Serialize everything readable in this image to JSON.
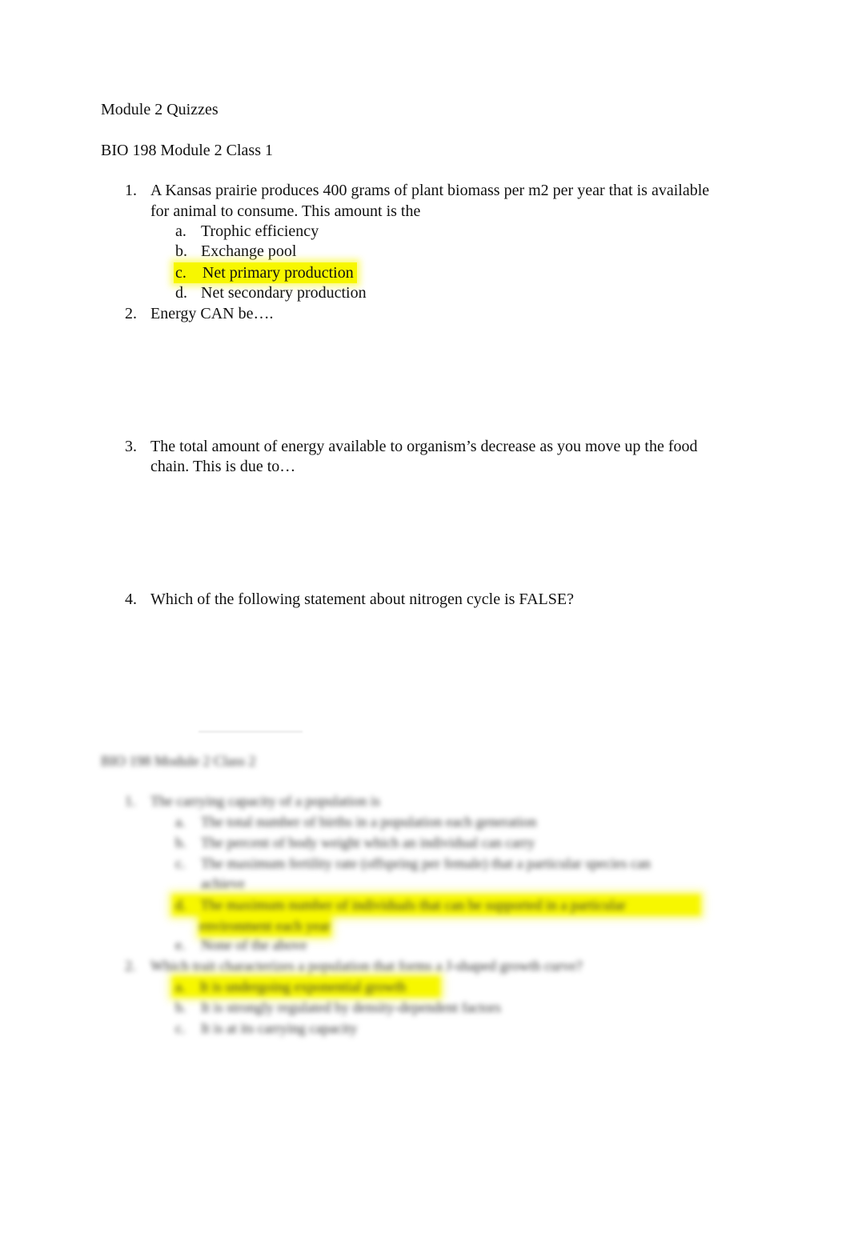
{
  "document": {
    "title": "Module 2 Quizzes",
    "section1": {
      "heading": "BIO 198 Module 2 Class 1",
      "questions": [
        {
          "num": "1.",
          "lines": [
            "A Kansas prairie produces 400 grams of plant biomass per m2 per year that is available",
            "for animal to consume. This amount is the"
          ],
          "options": [
            {
              "letter": "a.",
              "text": "Trophic efficiency",
              "highlighted": false
            },
            {
              "letter": "b.",
              "text": "Exchange pool",
              "highlighted": false
            },
            {
              "letter": "c.",
              "text": "Net primary production",
              "highlighted": true
            },
            {
              "letter": "d.",
              "text": "Net secondary production",
              "highlighted": false
            }
          ]
        },
        {
          "num": "2.",
          "lines": [
            "Energy CAN be…."
          ]
        },
        {
          "num": "3.",
          "lines": [
            "The total amount of energy available to organism’s decrease as you move up the food",
            "chain. This is due to…"
          ]
        },
        {
          "num": "4.",
          "lines": [
            "Which of the following statement about nitrogen cycle is FALSE?"
          ]
        }
      ]
    },
    "section2_blurred": {
      "heading": "BIO 198 Module 2 Class 2",
      "questions": [
        {
          "num": "1.",
          "lines": [
            "The carrying capacity of a population is"
          ],
          "options": [
            {
              "letter": "a.",
              "lines": [
                "The total number of births in a population each generation"
              ],
              "highlighted": false
            },
            {
              "letter": "b.",
              "lines": [
                "The percent of body weight which an individual can carry"
              ],
              "highlighted": false
            },
            {
              "letter": "c.",
              "lines": [
                "The maximum fertility rate (offspring per female) that a particular species can",
                "achieve"
              ],
              "highlighted": false
            },
            {
              "letter": "d.",
              "lines": [
                "The maximum number of individuals that can be supported in a particular",
                "environment each year"
              ],
              "highlighted": true
            },
            {
              "letter": "e.",
              "lines": [
                "None of the above"
              ],
              "highlighted": false
            }
          ]
        },
        {
          "num": "2.",
          "lines": [
            "Which trait characterizes a population that forms a J-shaped growth curve?"
          ],
          "options": [
            {
              "letter": "a.",
              "lines": [
                "It is undergoing exponential growth"
              ],
              "highlighted": true
            },
            {
              "letter": "b.",
              "lines": [
                "It is strongly regulated by density-dependent factors"
              ],
              "highlighted": false
            },
            {
              "letter": "c.",
              "lines": [
                "It is at its carrying capacity"
              ],
              "highlighted": false
            }
          ]
        }
      ]
    }
  },
  "colors": {
    "highlight": "#f7f700",
    "text": "#111111"
  }
}
